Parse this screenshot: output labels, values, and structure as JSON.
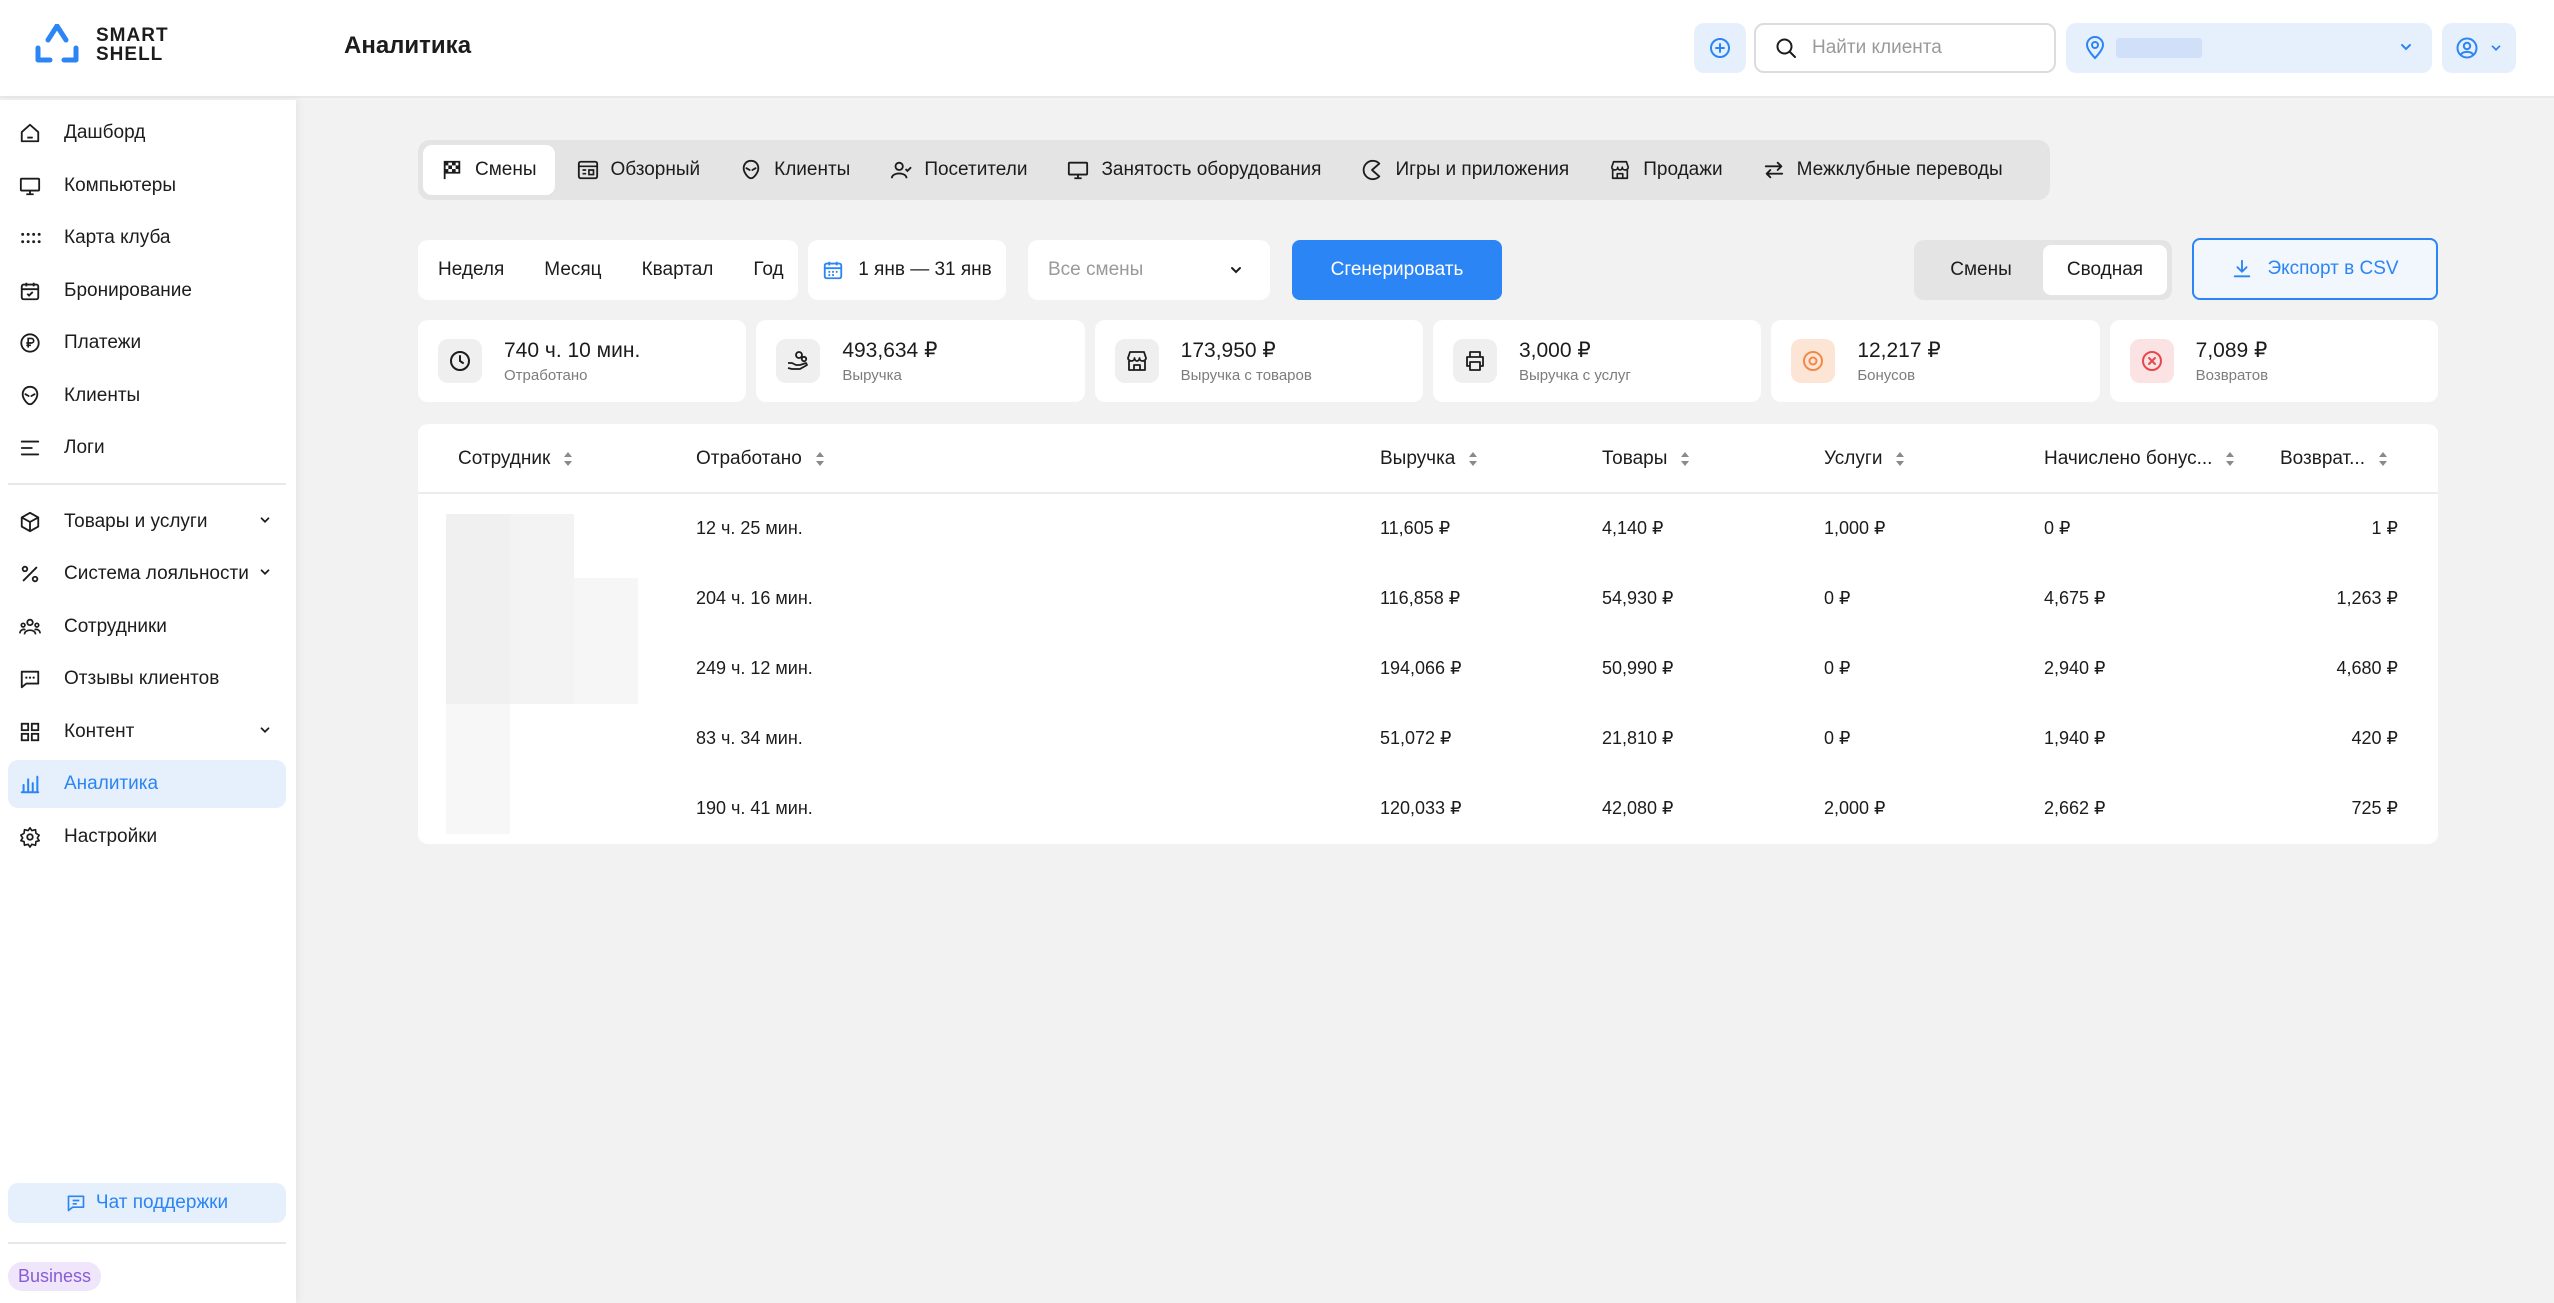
{
  "brand": {
    "line1": "SMART",
    "line2": "SHELL"
  },
  "header": {
    "title": "Аналитика",
    "search_placeholder": "Найти клиента"
  },
  "sidebar": {
    "items": [
      {
        "label": "Дашборд",
        "icon": "home-icon"
      },
      {
        "label": "Компьютеры",
        "icon": "monitor-icon"
      },
      {
        "label": "Карта клуба",
        "icon": "grid-dots-icon"
      },
      {
        "label": "Бронирование",
        "icon": "calendar-icon"
      },
      {
        "label": "Платежи",
        "icon": "ruble-circle-icon"
      },
      {
        "label": "Клиенты",
        "icon": "alien-icon"
      },
      {
        "label": "Логи",
        "icon": "lines-icon"
      },
      {
        "label": "Товары и услуги",
        "icon": "box-icon"
      },
      {
        "label": "Система лояльности",
        "icon": "percent-icon"
      },
      {
        "label": "Сотрудники",
        "icon": "people-icon"
      },
      {
        "label": "Отзывы клиентов",
        "icon": "chat-icon"
      },
      {
        "label": "Контент",
        "icon": "tiles-icon"
      },
      {
        "label": "Аналитика",
        "icon": "bar-chart-icon"
      },
      {
        "label": "Настройки",
        "icon": "gear-icon"
      }
    ],
    "support_label": "Чат поддержки",
    "plan_label": "Business"
  },
  "tabs": [
    {
      "label": "Смены",
      "icon": "flag-icon"
    },
    {
      "label": "Обзорный",
      "icon": "dashboard-icon"
    },
    {
      "label": "Клиенты",
      "icon": "alien-icon"
    },
    {
      "label": "Посетители",
      "icon": "person-icon"
    },
    {
      "label": "Занятость оборудования",
      "icon": "monitor-icon"
    },
    {
      "label": "Игры и приложения",
      "icon": "pacman-icon"
    },
    {
      "label": "Продажи",
      "icon": "store-icon"
    },
    {
      "label": "Межклубные переводы",
      "icon": "transfer-icon"
    }
  ],
  "filters": {
    "periods": [
      "Неделя",
      "Месяц",
      "Квартал",
      "Год"
    ],
    "date_range": "1 янв — 31 янв",
    "shift_placeholder": "Все смены",
    "generate_label": "Сгенерировать",
    "view_options": [
      "Смены",
      "Сводная"
    ],
    "export_label": "Экспорт в CSV"
  },
  "stats": [
    {
      "value": "740 ч. 10 мин.",
      "label": "Отработано",
      "icon": "clock-icon"
    },
    {
      "value": "493,634 ₽",
      "label": "Выручка",
      "icon": "hand-coins-icon"
    },
    {
      "value": "173,950 ₽",
      "label": "Выручка с товаров",
      "icon": "store-icon"
    },
    {
      "value": "3,000 ₽",
      "label": "Выручка с услуг",
      "icon": "printer-icon"
    },
    {
      "value": "12,217 ₽",
      "label": "Бонусов",
      "icon": "bonus-icon"
    },
    {
      "value": "7,089 ₽",
      "label": "Возвратов",
      "icon": "cancel-icon"
    }
  ],
  "table": {
    "columns": [
      "Сотрудник",
      "Отработано",
      "Выручка",
      "Товары",
      "Услуги",
      "Начислено бонус...",
      "Возврат..."
    ],
    "rows": [
      {
        "worked": "12 ч. 25 мин.",
        "revenue": "11,605 ₽",
        "goods": "4,140 ₽",
        "services": "1,000 ₽",
        "bonus": "0 ₽",
        "refunds": "1 ₽"
      },
      {
        "worked": "204 ч. 16 мин.",
        "revenue": "116,858 ₽",
        "goods": "54,930 ₽",
        "services": "0 ₽",
        "bonus": "4,675 ₽",
        "refunds": "1,263 ₽"
      },
      {
        "worked": "249 ч. 12 мин.",
        "revenue": "194,066 ₽",
        "goods": "50,990 ₽",
        "services": "0 ₽",
        "bonus": "2,940 ₽",
        "refunds": "4,680 ₽"
      },
      {
        "worked": "83 ч. 34 мин.",
        "revenue": "51,072 ₽",
        "goods": "21,810 ₽",
        "services": "0 ₽",
        "bonus": "1,940 ₽",
        "refunds": "420 ₽"
      },
      {
        "worked": "190 ч. 41 мин.",
        "revenue": "120,033 ₽",
        "goods": "42,080 ₽",
        "services": "2,000 ₽",
        "bonus": "2,662 ₽",
        "refunds": "725 ₽"
      }
    ]
  },
  "colors": {
    "accent": "#2b85f5",
    "accent_light": "#e6f0fc",
    "background": "#f2f2f2"
  }
}
